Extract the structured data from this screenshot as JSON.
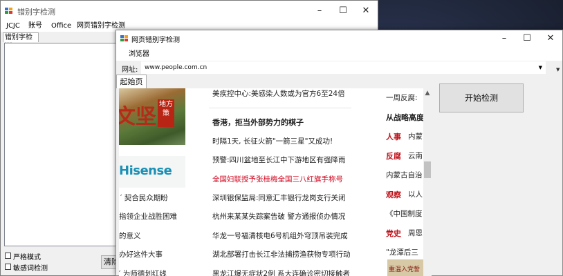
{
  "back_window": {
    "title": "错别字检测",
    "menu": [
      "JCJC",
      "账号",
      "Office",
      "网页错别字检测"
    ],
    "tab": "错别字检测",
    "checkbox_strict": "严格模式",
    "checkbox_sensitive": "敏感词检测",
    "clear_button": "清除"
  },
  "front_window": {
    "title": "网页错别字检测",
    "menu_browser": "浏览器",
    "url_label": "网址:",
    "url_value": "www.people.com.cn",
    "tab_start": "起始页",
    "start_button": "开始检测"
  },
  "web": {
    "img_big_text": "文坚",
    "img_seal": "地方策",
    "logo": "Hisense",
    "col1": [
      "′ 契合民众期盼",
      "指领企业战胜困难",
      "的意义",
      "办好这件大事",
      "′ 为师德划红线"
    ],
    "col2_top": "美疾控中心:美感染人数或为官方6至24倍",
    "col2_headline": "香港，拒当外部势力的棋子",
    "col2_items": [
      {
        "text": "时隔1天, 长征火箭\"一箭三星\"又成功!",
        "red": false
      },
      {
        "text": "预警:四川盆地至长江中下游地区有强降雨",
        "red": false
      },
      {
        "text": "全国妇联授予张桂梅全国三八红旗手称号",
        "red": true
      },
      {
        "text": "深圳银保监局:同意汇丰银行龙岗支行关闭",
        "red": false
      },
      {
        "text": "杭州来某某失踪案告破 警方通报侦办情况",
        "red": false
      },
      {
        "text": "华龙一号福清核电6号机组外穹顶吊装完成",
        "red": false
      },
      {
        "text": "湖北部署打击长江非法捕捞渔获物专项行动",
        "red": false
      },
      {
        "text": "黑龙江爆无症状2例 系大连确诊密切接触者",
        "red": false
      }
    ],
    "col3_top": "一周反腐:",
    "col3_head": "从战略高度",
    "col3": [
      {
        "key": "人事",
        "rest": "内蒙"
      },
      {
        "key": "反腐",
        "rest": "云南"
      },
      {
        "key": "",
        "rest": "内蒙古自治"
      },
      {
        "key": "观察",
        "rest": "以人"
      },
      {
        "key": "",
        "rest": "《中国制度"
      },
      {
        "key": "党史",
        "rest": "周恩"
      },
      {
        "key": "",
        "rest": "\"龙潭后三"
      }
    ],
    "col3_img_text": "重温入党誓"
  }
}
